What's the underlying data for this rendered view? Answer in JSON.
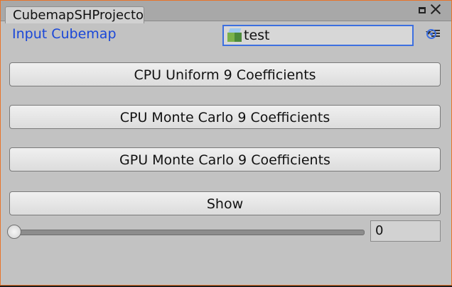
{
  "window": {
    "tab_title": "CubemapSHProjector"
  },
  "input": {
    "label": "Input Cubemap",
    "value": "test"
  },
  "buttons": {
    "cpu_uniform": "CPU Uniform 9 Coefficients",
    "cpu_monte_carlo": "CPU Monte Carlo 9 Coefficients",
    "gpu_monte_carlo": "GPU Monte Carlo 9 Coefficients",
    "show": "Show"
  },
  "slider": {
    "value": "0",
    "fraction": 0
  },
  "colors": {
    "accent": "#e8742a",
    "label_blue": "#1a47d8"
  }
}
